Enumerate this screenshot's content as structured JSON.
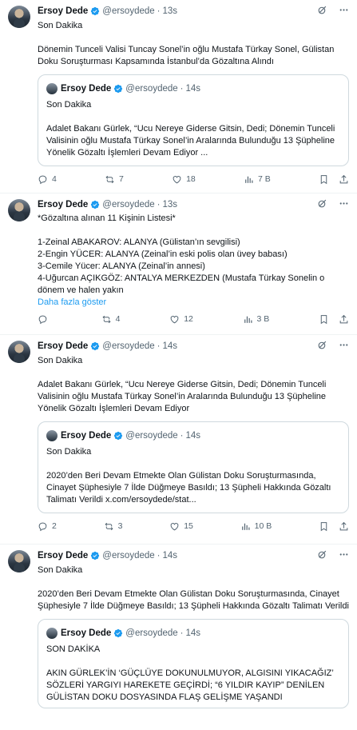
{
  "tweets": [
    {
      "name": "Ersoy Dede",
      "handle": "@ersoydede",
      "dot": "·",
      "time": "13s",
      "text": "Son Dakika\n\nDönemin Tunceli Valisi Tuncay Sonel’in oğlu Mustafa Türkay Sonel, Gülistan Doku Soruşturması Kapsamında İstanbul’da Gözaltına Alındı",
      "quote": {
        "name": "Ersoy Dede",
        "handle": "@ersoydede",
        "time": "14s",
        "text": "Son Dakika\n\nAdalet Bakanı Gürlek, “Ucu Nereye Giderse Gitsin, Dedi; Dönemin Tunceli Valisinin oğlu Mustafa Türkay Sonel’in Aralarında Bulunduğu 13 Şüpheline Yönelik Gözaltı İşlemleri Devam Ediyor ..."
      },
      "stats": {
        "replies": "4",
        "reposts": "7",
        "likes": "18",
        "views": "7 B"
      }
    },
    {
      "name": "Ersoy Dede",
      "handle": "@ersoydede",
      "dot": "·",
      "time": "13s",
      "text": "*Gözaltına alınan 11 Kişinin Listesi*\n\n1-Zeinal ABAKAROV: ALANYA (Gülistan’ın sevgilisi)\n2-Engin YÜCER: ALANYA (Zeinal’in eski polis olan üvey babası)\n3-Cemile Yücer: ALANYA (Zeinal’in annesi)\n4-Uğurcan AÇIKGÖZ: ANTALYA MERKEZDEN (Mustafa Türkay Sonelin o dönem ve halen yakın",
      "more": "Daha fazla göster",
      "stats": {
        "replies": "",
        "reposts": "4",
        "likes": "12",
        "views": "3 B"
      }
    },
    {
      "name": "Ersoy Dede",
      "handle": "@ersoydede",
      "dot": "·",
      "time": "14s",
      "text": "Son Dakika\n\nAdalet Bakanı Gürlek, “Ucu Nereye Giderse Gitsin, Dedi; Dönemin Tunceli Valisinin oğlu Mustafa Türkay Sonel’in Aralarında Bulunduğu 13 Şüpheline Yönelik Gözaltı İşlemleri Devam Ediyor",
      "quote": {
        "name": "Ersoy Dede",
        "handle": "@ersoydede",
        "time": "14s",
        "text": "Son Dakika\n\n2020’den Beri Devam Etmekte Olan Gülistan Doku Soruşturmasında, Cinayet Şüphesiyle 7 İlde Düğmeye Basıldı; 13 Şüpheli Hakkında Gözaltı Talimatı Verildi x.com/ersoydede/stat..."
      },
      "stats": {
        "replies": "2",
        "reposts": "3",
        "likes": "15",
        "views": "10 B"
      }
    },
    {
      "name": "Ersoy Dede",
      "handle": "@ersoydede",
      "dot": "·",
      "time": "14s",
      "text": "Son Dakika\n\n2020’den Beri Devam Etmekte Olan Gülistan Doku Soruşturmasında, Cinayet Şüphesiyle 7 İlde Düğmeye Basıldı; 13 Şüpheli Hakkında Gözaltı Talimatı Verildi",
      "quote": {
        "name": "Ersoy Dede",
        "handle": "@ersoydede",
        "time": "14s",
        "text": "SON DAKİKA\n\nAKIN GÜRLEK’İN ‘GÜÇLÜYE DOKUNULMUYOR, ALGISINI YIKACAĞIZ’ SÖZLERİ YARGIYI HAREKETE GEÇİRDİ; “6 YILDIR KAYIP” DENİLEN GÜLİSTAN DOKU DOSYASINDA FLAŞ GELİŞME YAŞANDI"
      }
    }
  ],
  "icons": {
    "verified": "verified-badge-icon",
    "grok": "grok-icon",
    "more": "more-dots-icon",
    "reply": "reply-icon",
    "repost": "repost-icon",
    "like": "heart-icon",
    "views": "views-icon",
    "bookmark": "bookmark-icon",
    "share": "share-icon"
  },
  "colors": {
    "accent": "#1d9bf0",
    "muted": "#536471",
    "border": "#cfd9de"
  }
}
